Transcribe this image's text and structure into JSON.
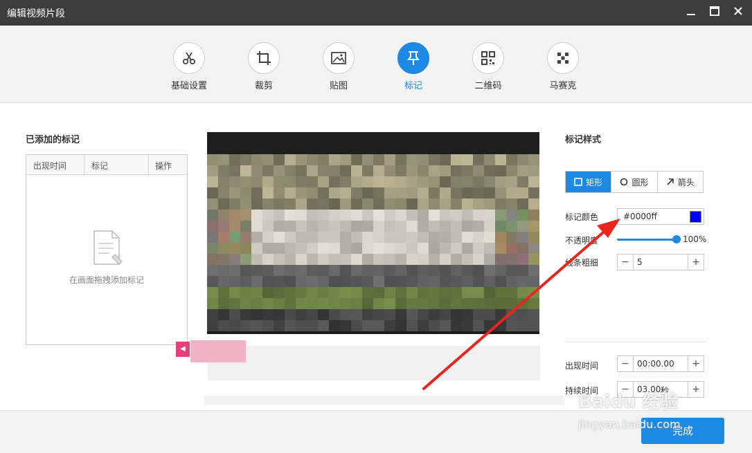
{
  "window": {
    "title": "编辑视频片段"
  },
  "toolbar": {
    "tools": [
      {
        "label": "基础设置",
        "icon": "scissors-icon",
        "active": false
      },
      {
        "label": "裁剪",
        "icon": "crop-icon",
        "active": false
      },
      {
        "label": "贴图",
        "icon": "image-icon",
        "active": false
      },
      {
        "label": "标记",
        "icon": "pin-icon",
        "active": true
      },
      {
        "label": "二维码",
        "icon": "qrcode-icon",
        "active": false
      },
      {
        "label": "马赛克",
        "icon": "mosaic-icon",
        "active": false
      }
    ]
  },
  "marks_panel": {
    "title": "已添加的标记",
    "columns": [
      "出现时间",
      "标记",
      "操作"
    ],
    "empty_text": "在画面拖拽添加标记"
  },
  "style_panel": {
    "title": "标记样式",
    "shapes": [
      {
        "label": "矩形",
        "active": true
      },
      {
        "label": "圆形",
        "active": false
      },
      {
        "label": "箭头",
        "active": false
      }
    ],
    "color_label": "标记颜色",
    "color_value": "#0000ff",
    "color_text": "#0000ff",
    "opacity_label": "不透明度",
    "opacity_value": "100%",
    "opacity_fraction": 1.0,
    "line_width_label": "线条粗细",
    "line_width_value": "5",
    "appear_label": "出现时间",
    "appear_value": "00:00.00",
    "duration_label": "持续时间",
    "duration_value": "03.00",
    "duration_unit": "秒"
  },
  "footer": {
    "done_label": "完成"
  },
  "watermark": {
    "text": "Baidu 经验",
    "url": "jingyan.baidu.com"
  },
  "colors": {
    "accent": "#1e88e5",
    "annotation_arrow": "#e8261f",
    "marker_pink": "#e6407a"
  }
}
